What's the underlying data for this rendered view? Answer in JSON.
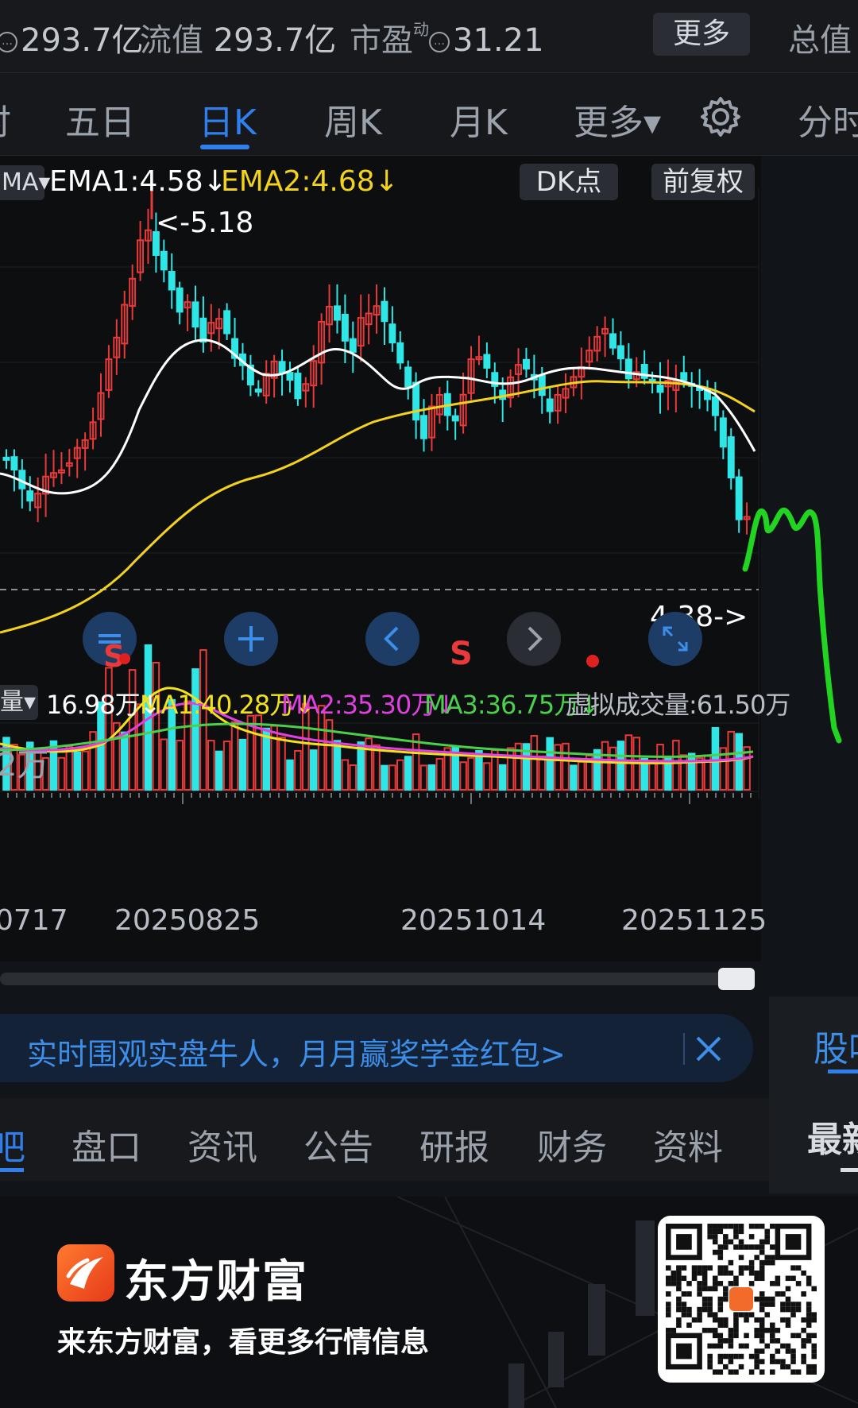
{
  "header": {
    "total_float_value": "293.7亿",
    "float_label": "流值",
    "float_value": "293.7亿",
    "pe_label": "市盈",
    "pe_sup": "动",
    "pe_value": "31.21",
    "more_button": "更多",
    "total_value_label": "总值"
  },
  "period_tabs": [
    {
      "label": "时"
    },
    {
      "label": "五日"
    },
    {
      "label": "日K",
      "active": true
    },
    {
      "label": "周K"
    },
    {
      "label": "月K"
    },
    {
      "label": "更多▾"
    },
    {
      "label": "分时"
    }
  ],
  "indicators": {
    "ma_selector": "MA▾",
    "ema1": "EMA1:4.58↓",
    "ema2": "EMA2:4.68↓",
    "dk_button": "DK点",
    "adjust_button": "前复权",
    "high_label": "<-5.18",
    "low_label": "4.38->"
  },
  "volume": {
    "selector": "量▾",
    "value": "16.98万↓",
    "ma1": "MA1:40.28万↓",
    "ma2": "MA2:35.30万↓",
    "ma3": "MA3:36.75万↓",
    "virtual": "虚拟成交量:61.50万",
    "axis_top": "2万"
  },
  "x_dates": [
    "0717",
    "20250825",
    "20251014",
    "20251125"
  ],
  "sell_marker": "S",
  "banner": {
    "text": "实时围观实盘牛人，月月赢奖学金红包>",
    "side_label": "股吧"
  },
  "bottom_tabs": [
    {
      "label": "吧",
      "active": true
    },
    {
      "label": "盘口"
    },
    {
      "label": "资讯"
    },
    {
      "label": "公告"
    },
    {
      "label": "研报"
    },
    {
      "label": "财务"
    },
    {
      "label": "资料"
    }
  ],
  "bottom_side": "最新",
  "footer": {
    "brand": "东方财富",
    "slogan": "来东方财富，看更多行情信息"
  },
  "colors": {
    "up": "#e83a3a",
    "down": "#2ee6e6",
    "ema1": "#ffffff",
    "ema2": "#f2d21c",
    "ma2_vol": "#e040e0",
    "ma3_vol": "#4ad04a",
    "accent": "#2f80ed"
  },
  "chart_data": {
    "type": "candlestick",
    "high": 5.18,
    "low": 4.38,
    "ema1_last": 4.58,
    "ema2_last": 4.68
  }
}
